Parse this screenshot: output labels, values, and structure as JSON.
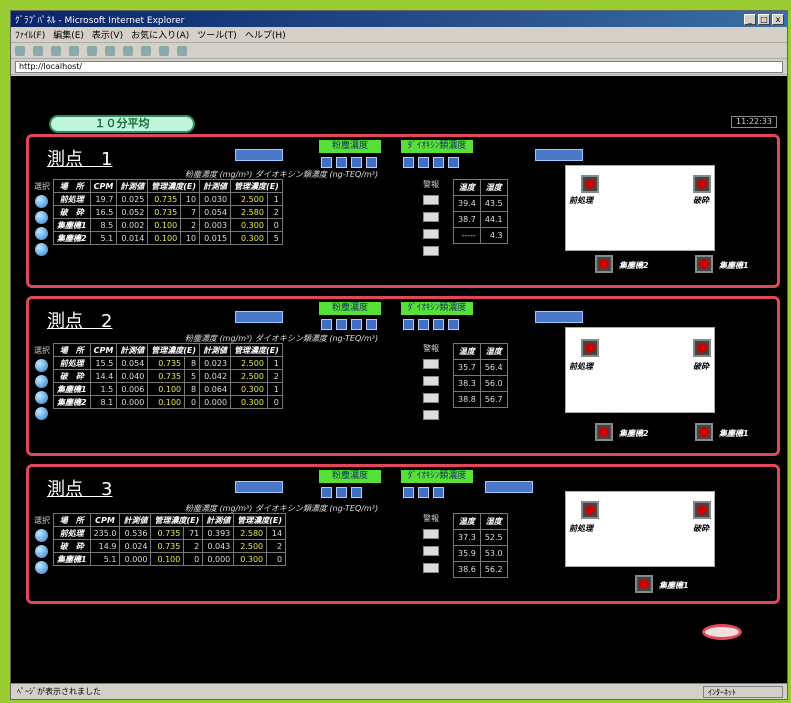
{
  "window": {
    "title": "ｸﾞﾗﾌﾞﾊﾟﾈﾙ - Microsoft Internet Explorer",
    "menu": [
      "ﾌｧｲﾙ(F)",
      "編集(E)",
      "表示(V)",
      "お気に入り(A)",
      "ツール(T)",
      "ヘルプ(H)"
    ],
    "address": "http://localhost/",
    "status": "ﾍﾟｰｼﾞが表示されました",
    "zone": "ｲﾝﾀｰﾈｯﾄ"
  },
  "header": {
    "pill": "１０分平均",
    "clock": "11:22:33"
  },
  "section_caption": "粉塵濃度 (mg/m³)  ダイオキシン類濃度 (ng-TEQ/m³)",
  "green_label": "粉塵濃度",
  "green_label2": "ﾀﾞｲｵｷｼﾝ類濃度",
  "panels": [
    {
      "title": "測点　1",
      "headers": [
        "場　所",
        "CPM",
        "計測値",
        "管理濃度(E)",
        "計測値",
        "管理濃度(E)"
      ],
      "rows": [
        [
          "前処理",
          "19.7",
          "0.025",
          "0.735",
          "10",
          "0.030",
          "2.500",
          "1"
        ],
        [
          "破　砕",
          "16.5",
          "0.052",
          "0.735",
          "7",
          "0.054",
          "2.580",
          "2"
        ],
        [
          "集塵機1",
          "8.5",
          "0.002",
          "0.100",
          "2",
          "0.003",
          "0.300",
          "0"
        ],
        [
          "集塵機2",
          "5.1",
          "0.014",
          "0.100",
          "10",
          "0.015",
          "0.300",
          "5"
        ]
      ],
      "right_headers": [
        "温度",
        "湿度"
      ],
      "right_rows": [
        [
          "39.4",
          "43.5"
        ],
        [
          "38.7",
          "44.1"
        ],
        [
          "-----",
          "4.3"
        ]
      ],
      "alarms": [
        "前処理",
        "破砕",
        "集塵機2",
        "集塵機1"
      ]
    },
    {
      "title": "測点　2",
      "headers": [
        "場　所",
        "CPM",
        "計測値",
        "管理濃度(E)",
        "計測値",
        "管理濃度(E)"
      ],
      "rows": [
        [
          "前処理",
          "15.5",
          "0.054",
          "0.735",
          "8",
          "0.023",
          "2.500",
          "1"
        ],
        [
          "破　砕",
          "14.4",
          "0.040",
          "0.735",
          "5",
          "0.042",
          "2.500",
          "2"
        ],
        [
          "集塵機1",
          "1.5",
          "0.006",
          "0.100",
          "8",
          "0.064",
          "0.300",
          "1"
        ],
        [
          "集塵機2",
          "8.1",
          "0.000",
          "0.100",
          "0",
          "0.000",
          "0.300",
          "0"
        ]
      ],
      "right_headers": [
        "温度",
        "湿度"
      ],
      "right_rows": [
        [
          "35.7",
          "56.4"
        ],
        [
          "38.3",
          "56.0"
        ],
        [
          "38.8",
          "56.7"
        ]
      ],
      "alarms": [
        "前処理",
        "破砕",
        "集塵機2",
        "集塵機1"
      ]
    },
    {
      "title": "測点　3",
      "headers": [
        "場　所",
        "CPM",
        "計測値",
        "管理濃度(E)",
        "計測値",
        "管理濃度(E)"
      ],
      "rows": [
        [
          "前処理",
          "235.0",
          "0.536",
          "0.735",
          "71",
          "0.393",
          "2.580",
          "14"
        ],
        [
          "破　砕",
          "14.9",
          "0.024",
          "0.735",
          "2",
          "0.043",
          "2.500",
          "2"
        ],
        [
          "集塵機1",
          "5.1",
          "0.000",
          "0.100",
          "0",
          "0.000",
          "0.300",
          "0"
        ]
      ],
      "right_headers": [
        "温度",
        "湿度"
      ],
      "right_rows": [
        [
          "37.3",
          "52.5"
        ],
        [
          "35.9",
          "53.0"
        ],
        [
          "38.6",
          "56.2"
        ]
      ],
      "alarms": [
        "前処理",
        "破砕",
        "集塵機1"
      ]
    }
  ]
}
